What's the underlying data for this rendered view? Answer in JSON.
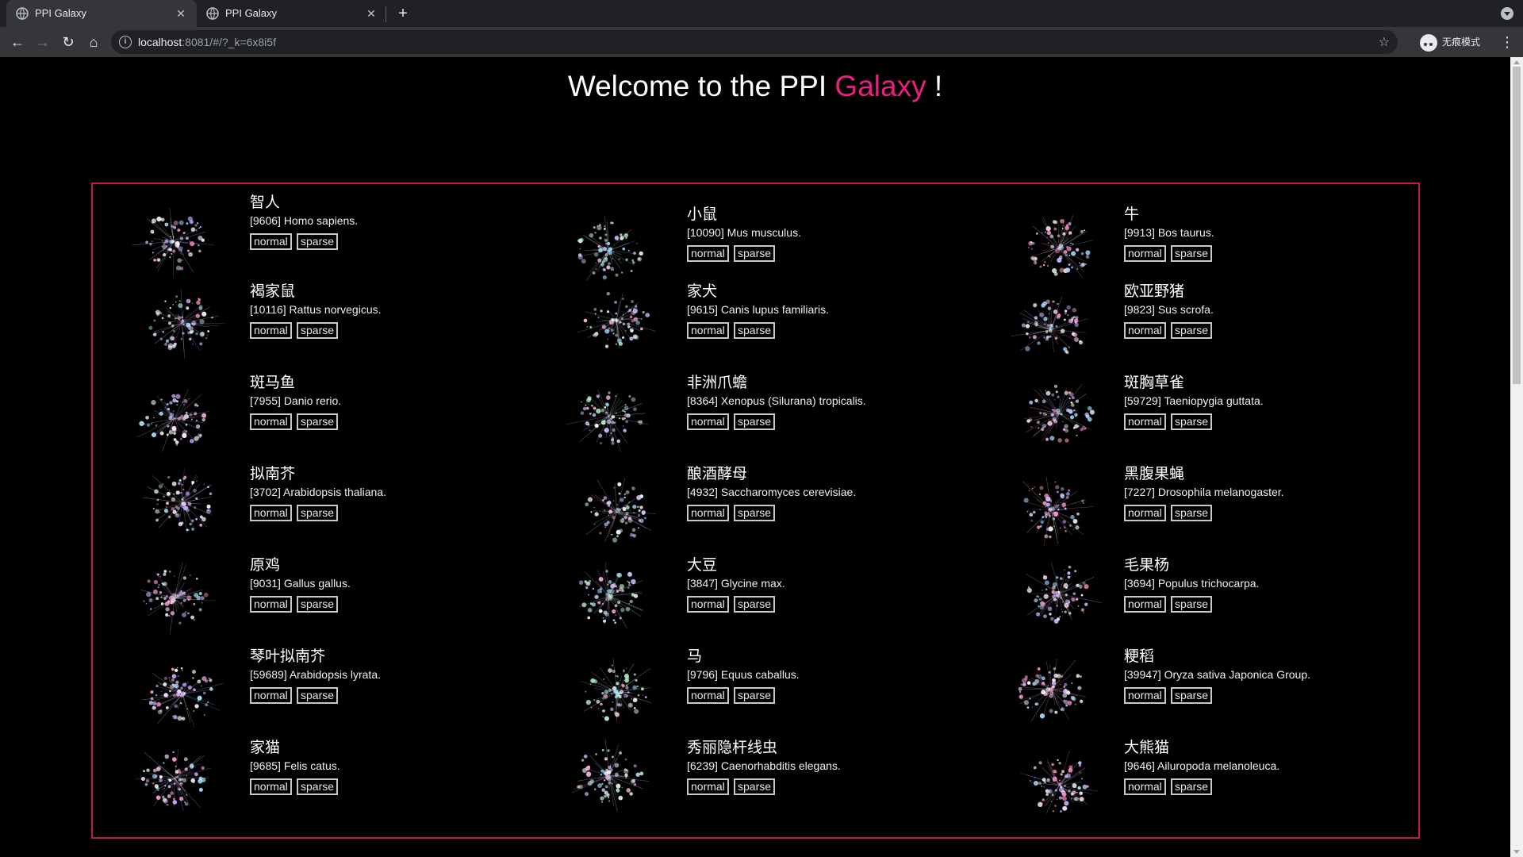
{
  "browser": {
    "tabs": [
      {
        "title": "PPI Galaxy",
        "active": true
      },
      {
        "title": "PPI Galaxy",
        "active": false
      }
    ],
    "url_host": "localhost",
    "url_rest": ":8081/#/?_k=6x8i5f",
    "incognito_label": "无痕模式"
  },
  "page": {
    "heading_prefix": "Welcome to the PPI ",
    "heading_accent": "Galaxy",
    "heading_suffix": " !",
    "accent_color": "#e91e80",
    "border_color": "#c2185b"
  },
  "species": [
    {
      "cn": "智人",
      "sci": "[9606] Homo sapiens.",
      "normal": "normal",
      "sparse": "sparse"
    },
    {
      "cn": "小鼠",
      "sci": "[10090] Mus musculus.",
      "normal": "normal",
      "sparse": "sparse"
    },
    {
      "cn": "牛",
      "sci": "[9913] Bos taurus.",
      "normal": "normal",
      "sparse": "sparse"
    },
    {
      "cn": "褐家鼠",
      "sci": "[10116] Rattus norvegicus.",
      "normal": "normal",
      "sparse": "sparse"
    },
    {
      "cn": "家犬",
      "sci": "[9615] Canis lupus familiaris.",
      "normal": "normal",
      "sparse": "sparse"
    },
    {
      "cn": "欧亚野猪",
      "sci": "[9823] Sus scrofa.",
      "normal": "normal",
      "sparse": "sparse"
    },
    {
      "cn": "斑马鱼",
      "sci": "[7955] Danio rerio.",
      "normal": "normal",
      "sparse": "sparse"
    },
    {
      "cn": "非洲爪蟾",
      "sci": "[8364] Xenopus (Silurana) tropicalis.",
      "normal": "normal",
      "sparse": "sparse"
    },
    {
      "cn": "斑胸草雀",
      "sci": "[59729] Taeniopygia guttata.",
      "normal": "normal",
      "sparse": "sparse"
    },
    {
      "cn": "拟南芥",
      "sci": "[3702] Arabidopsis thaliana.",
      "normal": "normal",
      "sparse": "sparse"
    },
    {
      "cn": "酿酒酵母",
      "sci": "[4932] Saccharomyces cerevisiae.",
      "normal": "normal",
      "sparse": "sparse"
    },
    {
      "cn": "黑腹果蝇",
      "sci": "[7227] Drosophila melanogaster.",
      "normal": "normal",
      "sparse": "sparse"
    },
    {
      "cn": "原鸡",
      "sci": "[9031] Gallus gallus.",
      "normal": "normal",
      "sparse": "sparse"
    },
    {
      "cn": "大豆",
      "sci": "[3847] Glycine max.",
      "normal": "normal",
      "sparse": "sparse"
    },
    {
      "cn": "毛果杨",
      "sci": "[3694] Populus trichocarpa.",
      "normal": "normal",
      "sparse": "sparse"
    },
    {
      "cn": "琴叶拟南芥",
      "sci": "[59689] Arabidopsis lyrata.",
      "normal": "normal",
      "sparse": "sparse"
    },
    {
      "cn": "马",
      "sci": "[9796] Equus caballus.",
      "normal": "normal",
      "sparse": "sparse"
    },
    {
      "cn": "粳稻",
      "sci": "[39947] Oryza sativa Japonica Group.",
      "normal": "normal",
      "sparse": "sparse"
    },
    {
      "cn": "家猫",
      "sci": "[9685] Felis catus.",
      "normal": "normal",
      "sparse": "sparse"
    },
    {
      "cn": "秀丽隐杆线虫",
      "sci": "[6239] Caenorhabditis elegans.",
      "normal": "normal",
      "sparse": "sparse"
    },
    {
      "cn": "大熊猫",
      "sci": "[9646] Ailuropoda melanoleuca.",
      "normal": "normal",
      "sparse": "sparse"
    }
  ]
}
